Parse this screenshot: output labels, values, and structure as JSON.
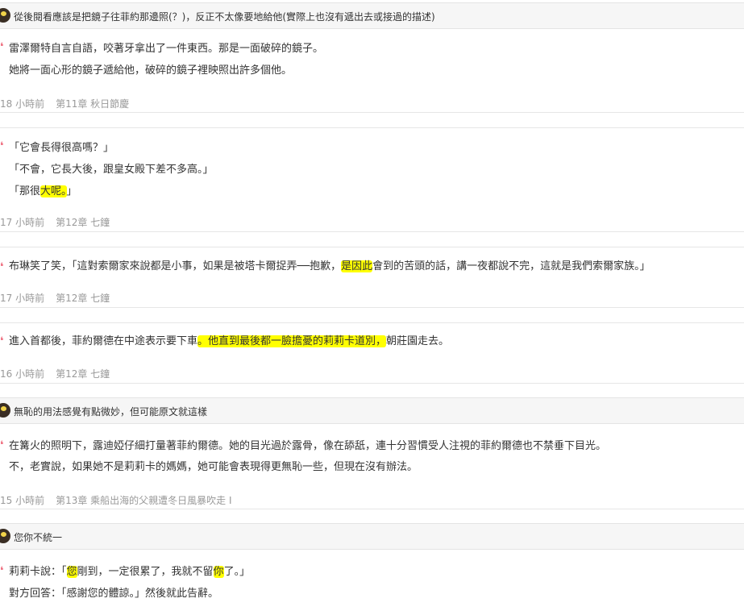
{
  "comments": {
    "c1": "從後閱看應該是把鏡子往菲約那邊照(？)，反正不太像要地給他(實際上也沒有遞出去或接過的描述)",
    "c2": "無恥的用法感覺有點微妙，但可能原文就這樣",
    "c3": "您你不統一"
  },
  "entries": [
    {
      "lines": [
        [
          "雷澤爾特自言自語，咬著牙拿出了一件東西。那是一面破碎的鏡子。"
        ],
        [
          "她將一面心形的鏡子遞給他，破碎的鏡子裡映照出許多個他。"
        ]
      ],
      "time": "18 小時前",
      "chapter": "第11章 秋日節慶"
    },
    {
      "lines": [
        [
          "「它會長得很高嗎？」"
        ],
        [
          "「不會，它長大後，跟皇女殿下差不多高。」"
        ],
        [
          "「那很",
          "大呢。",
          "」"
        ]
      ],
      "time": "17 小時前",
      "chapter": "第12章 七鐘"
    },
    {
      "lines": [
        [
          "布琳笑了笑，「這對索爾家來說都是小事，如果是被塔卡爾捉弄──抱歉，",
          "是因此",
          "會到的苦頭的話，講一夜都說不完，這就是我們索爾家族。」"
        ]
      ],
      "time": "17 小時前",
      "chapter": "第12章 七鐘"
    },
    {
      "lines": [
        [
          "進入首都後，菲約爾德在中途表示要下車",
          "。他直到最後都一臉擔憂的莉莉卡道別，",
          "朝莊園走去。"
        ]
      ],
      "time": "16 小時前",
      "chapter": "第12章 七鐘"
    },
    {
      "lines": [
        [
          "在篝火的照明下，露迪婭仔細打量著菲約爾德。她的目光過於露骨，像在舔舐，連十分習慣受人注視的菲約爾德也不禁垂下目光。"
        ],
        [
          "不，老實說，如果她不是莉莉卡的媽媽，她可能會表現得更無恥一些，但現在沒有辦法。"
        ]
      ],
      "time": "15 小時前",
      "chapter": "第13章 乘船出海的父親遭冬日風暴吹走 I"
    },
    {
      "lines": [
        [
          "莉莉卡說：「",
          "您",
          "剛到，一定很累了，我就不留",
          "你",
          "了。」"
        ],
        [
          "對方回答：「感謝您的體諒。」然後就此告辭。"
        ]
      ],
      "time": "",
      "chapter": ""
    }
  ],
  "colors": {
    "highlight": "#ffff00",
    "quote": "#ee6a7b",
    "meta": "#999999"
  },
  "icons": {
    "avatar": "avatar-icon",
    "quote": "quote-icon"
  }
}
